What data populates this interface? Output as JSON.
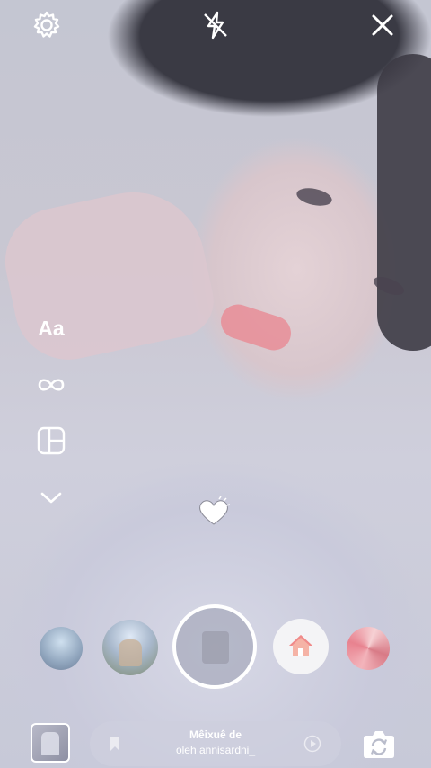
{
  "top_bar": {
    "settings_icon": "gear-icon",
    "flash_icon": "flash-off-icon",
    "close_icon": "close-icon"
  },
  "tools": {
    "text_label": "Aa",
    "boomerang_icon": "infinity-icon",
    "layout_icon": "layout-icon",
    "more_icon": "chevron-down-icon"
  },
  "effects": {
    "items": [
      "effect-1",
      "effect-2",
      "capture",
      "effect-home",
      "effect-5"
    ],
    "home_icon": "home-icon"
  },
  "bottom_bar": {
    "music_title": "Mêixuê de",
    "music_artist": "oleh annisardni_",
    "bookmark_icon": "bookmark-icon",
    "play_icon": "play-icon",
    "switch_camera_icon": "switch-camera-icon"
  },
  "colors": {
    "icon": "#ffffff",
    "home_roof": "#f08a8a",
    "home_body": "#f5b3a6"
  }
}
